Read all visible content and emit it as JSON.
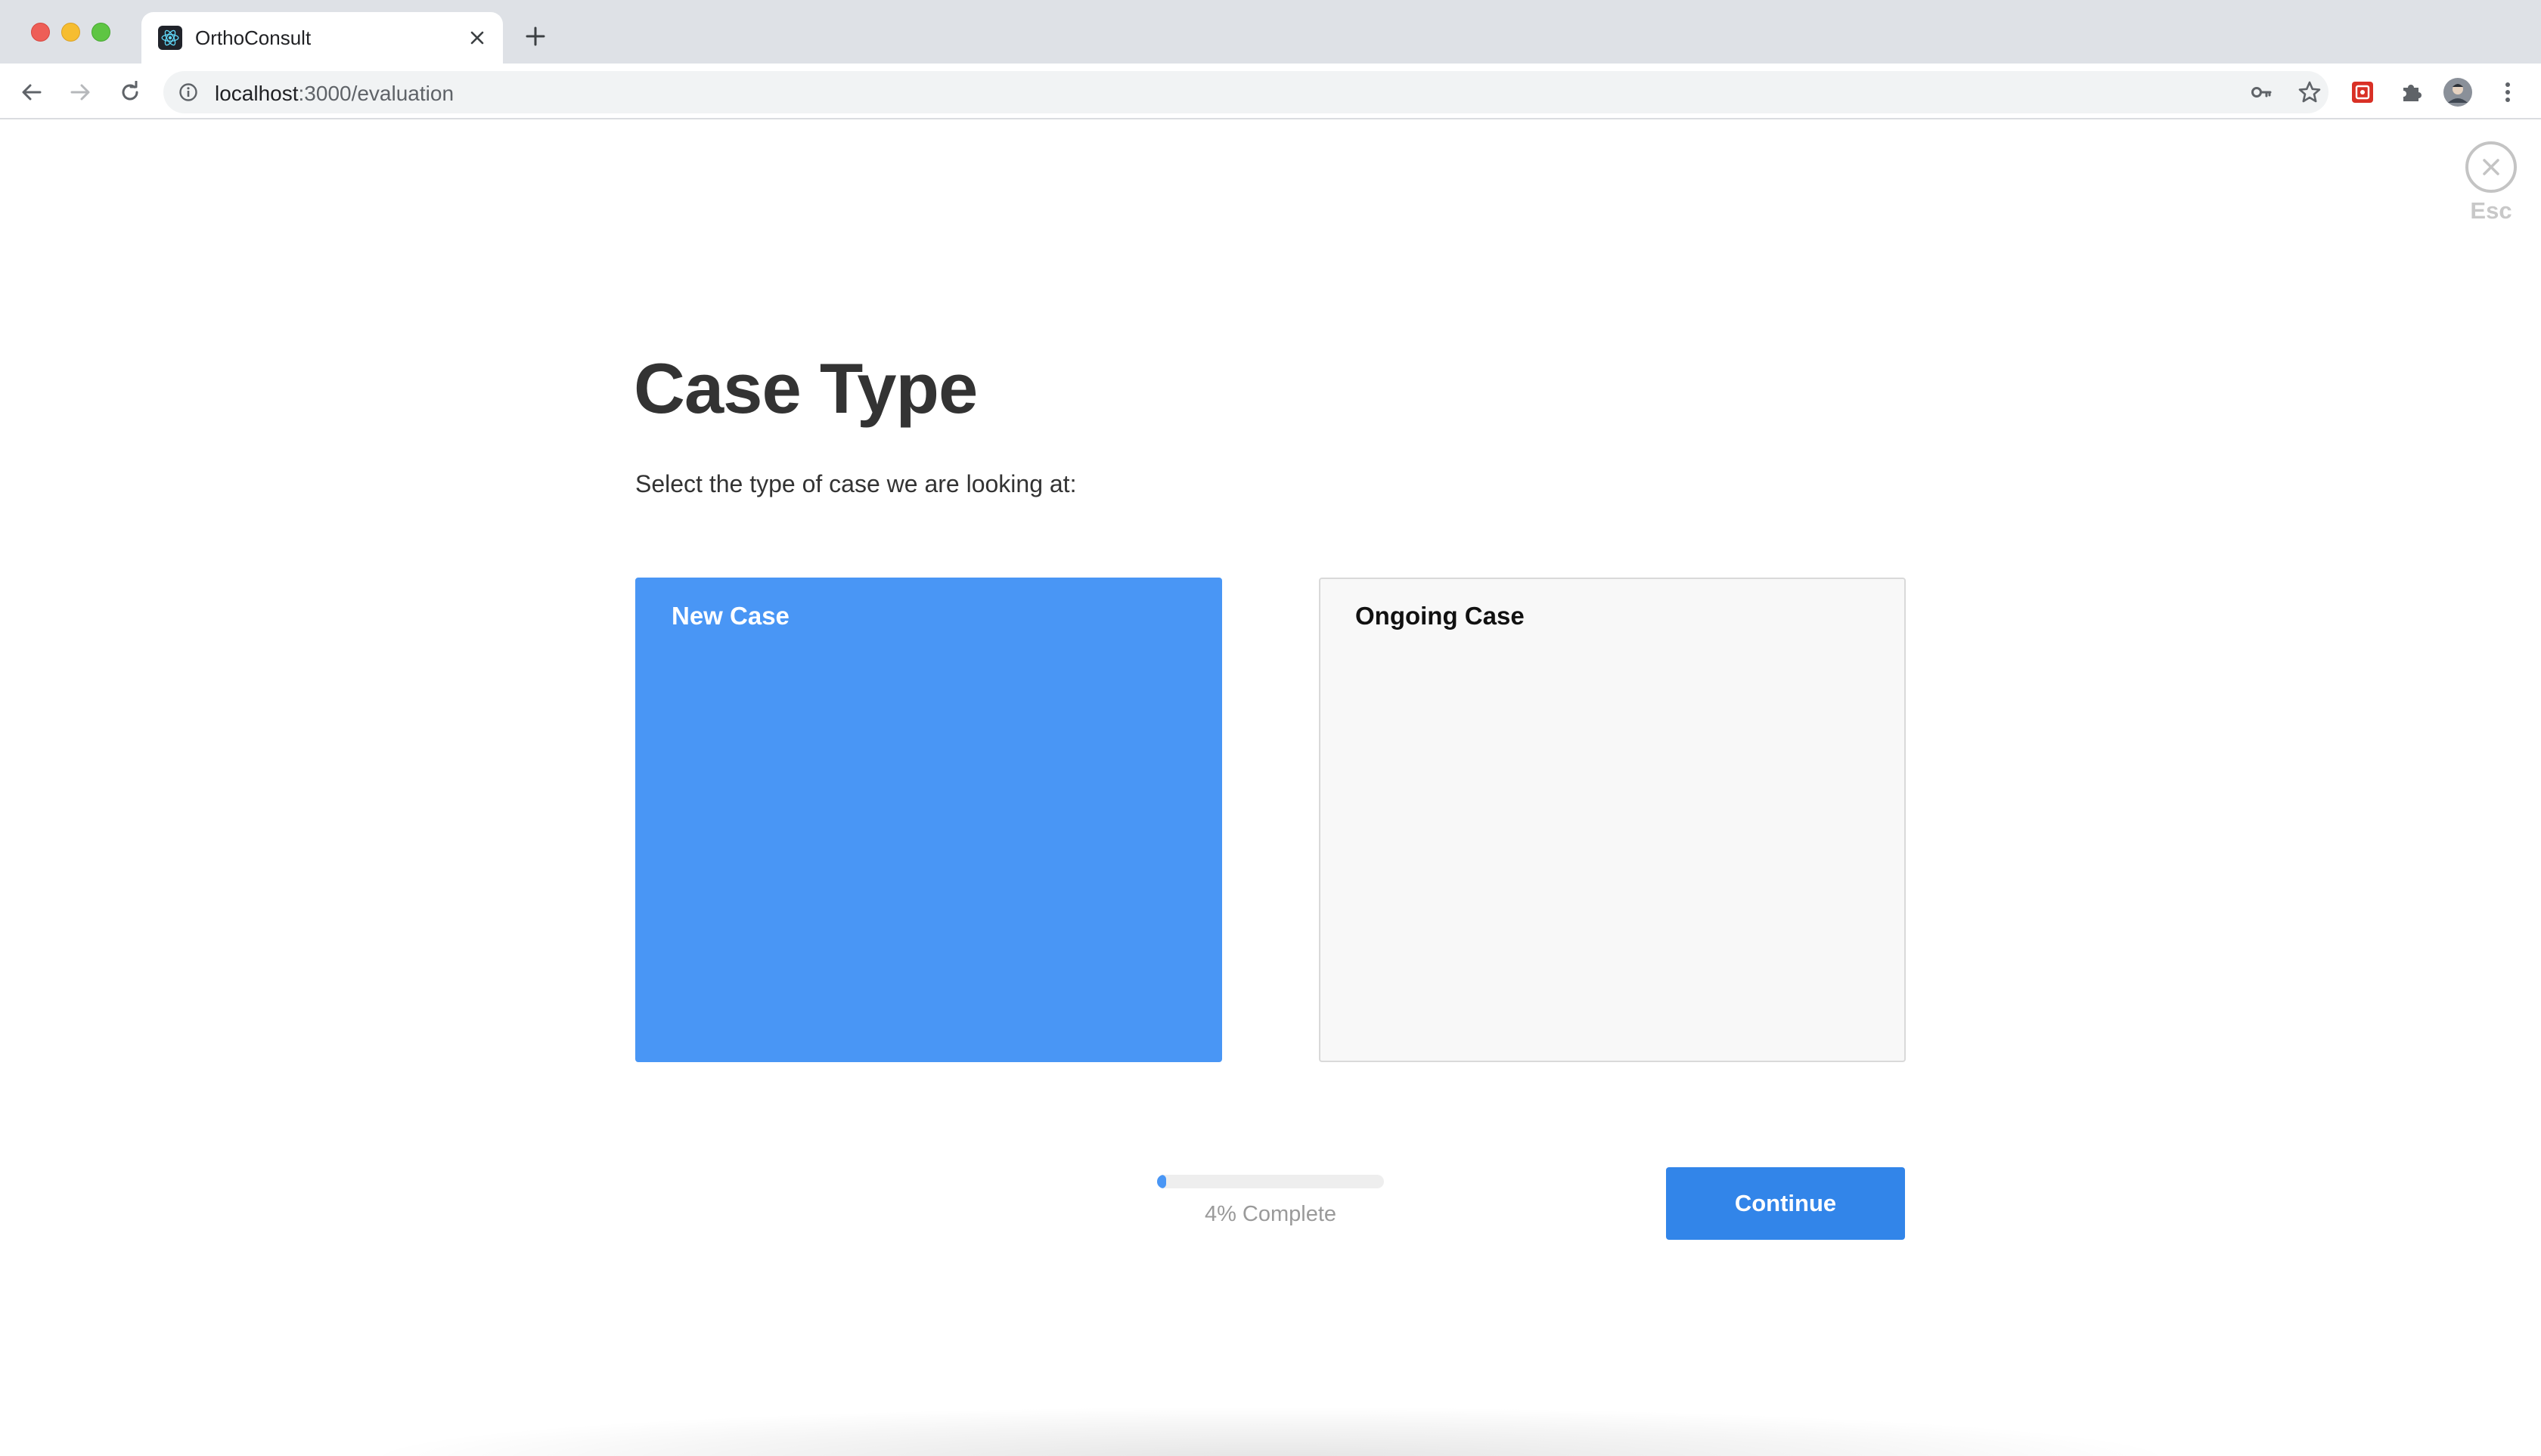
{
  "browser": {
    "tab": {
      "title": "OrthoConsult",
      "favicon": "react-atom-icon",
      "close_icon": "close-icon"
    },
    "new_tab_icon": "plus-icon",
    "address_bar": {
      "host": "localhost",
      "path": ":3000/evaluation",
      "info_icon": "info-icon"
    },
    "toolbar_icons": [
      "back-arrow-icon",
      "forward-arrow-icon",
      "reload-icon",
      "key-icon",
      "star-icon",
      "extension-icon",
      "puzzle-icon",
      "profile-avatar",
      "kebab-menu-icon"
    ]
  },
  "page": {
    "esc": {
      "label": "Esc",
      "icon": "close-circle-icon"
    },
    "title": "Case Type",
    "subtitle": "Select the type of case we are looking at:",
    "options": [
      {
        "label": "New Case",
        "selected": true
      },
      {
        "label": "Ongoing Case",
        "selected": false
      }
    ],
    "progress": {
      "percent": 4,
      "label": "4% Complete"
    },
    "continue_label": "Continue"
  },
  "colors": {
    "selected_card": "#4996f5",
    "unselected_card": "#f8f8f8",
    "continue_button": "#3285e9",
    "progress_fill": "#4996f5",
    "heading_text": "#333333"
  }
}
